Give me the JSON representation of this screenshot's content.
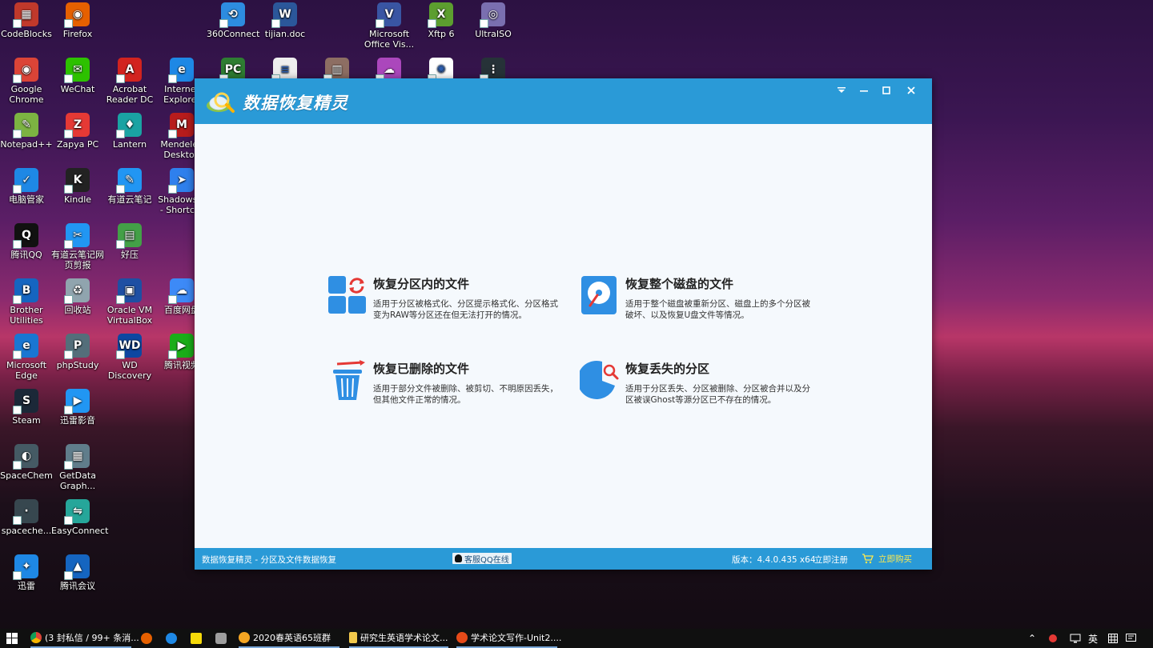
{
  "desktop": {
    "icons": [
      {
        "label": "CodeBlocks",
        "color": "#c0392b",
        "char": "▦"
      },
      {
        "label": "Firefox",
        "color": "#e66000",
        "char": "◉"
      },
      {
        "label": "360Connect",
        "color": "#2d8ce0",
        "char": "⟲"
      },
      {
        "label": "tijian.doc",
        "color": "#2b579a",
        "char": "W"
      },
      {
        "label": "Microsoft\nOffice Vis...",
        "color": "#3955a3",
        "char": "V"
      },
      {
        "label": "Xftp 6",
        "color": "#5c9e2f",
        "char": "X"
      },
      {
        "label": "UltraISO",
        "color": "#7a6fb0",
        "char": "◎"
      },
      {
        "label": "Google\nChrome",
        "color": "#db4437",
        "char": "◉"
      },
      {
        "label": "WeChat",
        "color": "#2dc100",
        "char": "✉"
      },
      {
        "label": "Acrobat\nReader DC",
        "color": "#d2231f",
        "char": "A"
      },
      {
        "label": "Internet\nExplorer",
        "color": "#1e88e5",
        "char": "e"
      },
      {
        "label": "Notepad++",
        "color": "#7cb342",
        "char": "✎"
      },
      {
        "label": "Zapya PC",
        "color": "#e53935",
        "char": "Z"
      },
      {
        "label": "Lantern",
        "color": "#1aa3a3",
        "char": "♦"
      },
      {
        "label": "Mendeley\nDesktop",
        "color": "#b71c1c",
        "char": "M"
      },
      {
        "label": "电脑管家",
        "color": "#1e88e5",
        "char": "✓"
      },
      {
        "label": "Kindle",
        "color": "#222222",
        "char": "K"
      },
      {
        "label": "有道云笔记",
        "color": "#2196f3",
        "char": "✎"
      },
      {
        "label": "Shadows...\n- Shortcut",
        "color": "#2f80ed",
        "char": "➤"
      },
      {
        "label": "腾讯QQ",
        "color": "#111111",
        "char": "Q"
      },
      {
        "label": "有道云笔记网\n页剪报",
        "color": "#2196f3",
        "char": "✂"
      },
      {
        "label": "好压",
        "color": "#43a047",
        "char": "▤"
      },
      {
        "label": "Brother\nUtilities",
        "color": "#1565c0",
        "char": "B"
      },
      {
        "label": "回收站",
        "color": "#90a4ae",
        "char": "♻"
      },
      {
        "label": "Oracle VM\nVirtualBox",
        "color": "#1e4fa3",
        "char": "▣"
      },
      {
        "label": "百度网盘",
        "color": "#3d8af7",
        "char": "☁"
      },
      {
        "label": "Microsoft\nEdge",
        "color": "#1976d2",
        "char": "e"
      },
      {
        "label": "phpStudy",
        "color": "#546e7a",
        "char": "P"
      },
      {
        "label": "WD\nDiscovery",
        "color": "#0d47a1",
        "char": "WD"
      },
      {
        "label": "腾讯视频",
        "color": "#1aad19",
        "char": "▶"
      },
      {
        "label": "Steam",
        "color": "#1b2838",
        "char": "S"
      },
      {
        "label": "迅雷影音",
        "color": "#2196f3",
        "char": "▶"
      },
      {
        "label": "SpaceChem",
        "color": "#455a64",
        "char": "◐"
      },
      {
        "label": "GetData\nGraph...",
        "color": "#607d8b",
        "char": "▦"
      },
      {
        "label": "spaceche...",
        "color": "#37474f",
        "char": "·"
      },
      {
        "label": "EasyConnect",
        "color": "#26a69a",
        "char": "⇋"
      },
      {
        "label": "迅雷",
        "color": "#1e88e5",
        "char": "✦"
      },
      {
        "label": "腾讯会议",
        "color": "#1565c0",
        "char": "▲"
      },
      {
        "label": "",
        "color": "#2e7d32",
        "char": "PC"
      },
      {
        "label": "",
        "color": "#eeeeee",
        "char": "≡"
      },
      {
        "label": "",
        "color": "#8d6e63",
        "char": "▥"
      },
      {
        "label": "",
        "color": "#ab47bc",
        "char": "☁"
      },
      {
        "label": "",
        "color": "#ffffff",
        "char": "✺"
      },
      {
        "label": "",
        "color": "#263238",
        "char": "⋮"
      }
    ]
  },
  "app": {
    "title": "数据恢复精灵",
    "cards": [
      {
        "title": "恢复分区内的文件",
        "desc": "适用于分区被格式化、分区提示格式化、分区格式变为RAW等分区还在但无法打开的情况。"
      },
      {
        "title": "恢复整个磁盘的文件",
        "desc": "适用于整个磁盘被重新分区、磁盘上的多个分区被破坏、以及恢复U盘文件等情况。"
      },
      {
        "title": "恢复已删除的文件",
        "desc": "适用于部分文件被删除、被剪切、不明原因丢失，但其他文件正常的情况。"
      },
      {
        "title": "恢复丢失的分区",
        "desc": "适用于分区丢失、分区被删除、分区被合并以及分区被误Ghost等源分区已不存在的情况。"
      }
    ],
    "status": {
      "left": "数据恢复精灵 - 分区及文件数据恢复",
      "qq": "客服QQ在线",
      "version": "版本：4.4.0.435 x64",
      "register": "立即注册",
      "buy": "立即购买"
    }
  },
  "taskbar": {
    "items": [
      {
        "label": "(3 封私信 / 99+ 条消...",
        "color": "#db4437"
      },
      {
        "label": "2020春英语65班群",
        "color": "#f5a623"
      },
      {
        "label": "研究生英语学术论文...",
        "color": "#f2c94c"
      },
      {
        "label": "学术论文写作-Unit2....",
        "color": "#e64a19"
      }
    ],
    "lang": "英"
  }
}
